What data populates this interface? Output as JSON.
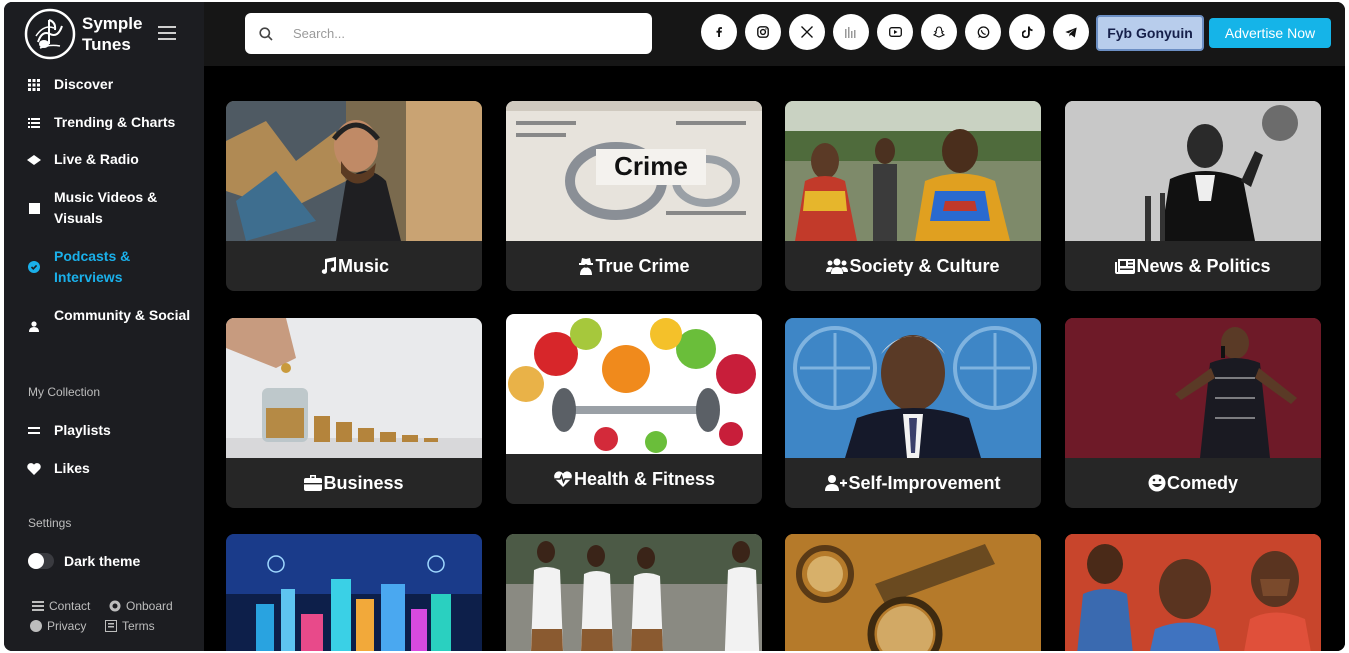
{
  "brand": {
    "name_line1": "Symple",
    "name_line2": "Tunes"
  },
  "sidebar": {
    "items": [
      {
        "label": "Discover",
        "icon": "grid-icon"
      },
      {
        "label": "Trending & Charts",
        "icon": "list-icon"
      },
      {
        "label": "Live & Radio",
        "icon": "radio-icon"
      },
      {
        "label": "Music Videos & Visuals",
        "icon": "video-icon"
      },
      {
        "label": "Podcasts & Interviews",
        "icon": "podcast-icon",
        "active": true
      },
      {
        "label": "Community & Social",
        "icon": "user-icon"
      }
    ],
    "collection_label": "My Collection",
    "collection": [
      {
        "label": "Playlists",
        "icon": "playlist-icon"
      },
      {
        "label": "Likes",
        "icon": "heart-icon"
      }
    ],
    "settings_label": "Settings",
    "dark_theme_label": "Dark theme",
    "footer": {
      "contact": "Contact",
      "onboard": "Onboard",
      "privacy": "Privacy",
      "terms": "Terms"
    }
  },
  "header": {
    "search_placeholder": "Search...",
    "socials": [
      "facebook-icon",
      "instagram-icon",
      "x-icon",
      "audiomack-icon",
      "youtube-icon",
      "snapchat-icon",
      "whatsapp-icon",
      "tiktok-icon",
      "telegram-icon"
    ],
    "user_button": "Fyb Gonyuin",
    "advertise_button": "Advertise Now"
  },
  "categories": [
    {
      "label": "Music",
      "icon": "music-note-icon"
    },
    {
      "label": "True Crime",
      "icon": "detective-icon"
    },
    {
      "label": "Society & Culture",
      "icon": "users-icon"
    },
    {
      "label": "News & Politics",
      "icon": "newspaper-icon"
    },
    {
      "label": "Business",
      "icon": "briefcase-icon"
    },
    {
      "label": "Health & Fitness",
      "icon": "heartbeat-icon"
    },
    {
      "label": "Self-Improvement",
      "icon": "user-plus-icon"
    },
    {
      "label": "Comedy",
      "icon": "laugh-icon"
    }
  ],
  "colors": {
    "accent": "#1ab0ea",
    "sidebar_bg": "#1c1d21",
    "card_bg": "#262626",
    "advertise_bg": "#15b4e8"
  }
}
